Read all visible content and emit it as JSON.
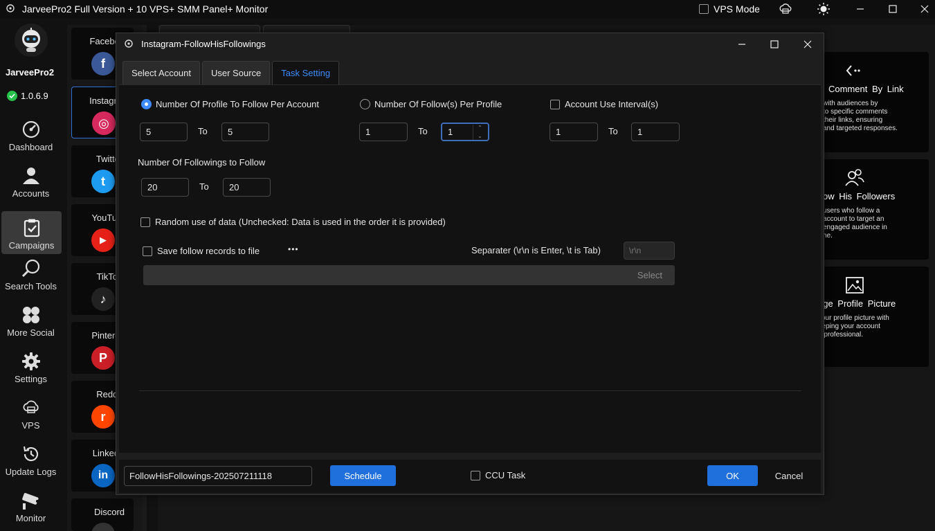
{
  "window": {
    "title": "JarveePro2 Full Version + 10 VPS+ SMM Panel+ Monitor",
    "vps_mode_label": "VPS Mode"
  },
  "brand": {
    "name": "JarveePro2",
    "version": "1.0.6.9"
  },
  "nav": [
    {
      "label": "Dashboard",
      "icon": "dashboard-icon"
    },
    {
      "label": "Accounts",
      "icon": "accounts-icon"
    },
    {
      "label": "Campaigns",
      "icon": "campaigns-icon",
      "active": true
    },
    {
      "label": "Search Tools",
      "icon": "search-icon"
    },
    {
      "label": "More Social",
      "icon": "more-social-icon"
    },
    {
      "label": "Settings",
      "icon": "gear-icon"
    },
    {
      "label": "VPS",
      "icon": "vps-icon"
    },
    {
      "label": "Update Logs",
      "icon": "update-logs-icon"
    },
    {
      "label": "Monitor",
      "icon": "monitor-icon"
    }
  ],
  "social": [
    {
      "name": "Facebook",
      "letter": "f",
      "color": "#3b5998"
    },
    {
      "name": "Instagram",
      "letter": "◎",
      "color": "#d6295e",
      "active": true
    },
    {
      "name": "Twitter",
      "letter": "t",
      "color": "#1d9bf0"
    },
    {
      "name": "YouTube",
      "letter": "▶",
      "color": "#e62117"
    },
    {
      "name": "TikTok",
      "letter": "♪",
      "color": "#222222"
    },
    {
      "name": "Pinterest",
      "letter": "P",
      "color": "#cb1f27"
    },
    {
      "name": "Reddit",
      "letter": "r",
      "color": "#ff4500"
    },
    {
      "name": "Linkedin",
      "letter": "in",
      "color": "#0a66c2"
    },
    {
      "name": "Discord",
      "letter": "",
      "color": "#333333"
    }
  ],
  "feature_cards": [
    {
      "title": "Comment By Link",
      "desc": "with audiences by\n to specific comments\n their links, ensuring\nand targeted responses.",
      "icon": "link-icon"
    },
    {
      "title": "ow His Followers",
      "desc": "users who follow a\n account to target an\n engaged audience in\nhe.",
      "icon": "followers-icon"
    },
    {
      "title": "nge Profile Picture",
      "desc": "your profile picture with\neeping your account\nd professional.",
      "icon": "picture-icon"
    }
  ],
  "dialog": {
    "title": "Instagram-FollowHisFollowings",
    "tabs": [
      "Select Account",
      "User Source",
      "Task Setting"
    ],
    "active_tab": 2,
    "options": {
      "profile_per_account": {
        "label": "Number Of Profile To Follow Per Account",
        "checked": true,
        "from": "5",
        "to": "5"
      },
      "follows_per_profile": {
        "label": "Number Of Follow(s) Per Profile",
        "checked": false,
        "from": "1",
        "to": "1"
      },
      "account_interval": {
        "label": "Account Use Interval(s)",
        "checked": false,
        "from": "1",
        "to": "1"
      },
      "to_label": "To",
      "followings_label": "Number Of Followings to Follow",
      "followings_from": "20",
      "followings_to": "20",
      "random_label": "Random use of data (Unchecked: Data is used in the order it is provided)",
      "save_label": "Save follow records to file",
      "more_label": "•••",
      "separator_label": "Separater (\\r\\n is Enter, \\t is Tab)",
      "separator_placeholder": "\\r\\n",
      "select_label": "Select"
    },
    "footer": {
      "task_name": "FollowHisFollowings-202507211118",
      "schedule_label": "Schedule",
      "ccu_label": "CCU Task",
      "ok_label": "OK",
      "cancel_label": "Cancel"
    }
  }
}
